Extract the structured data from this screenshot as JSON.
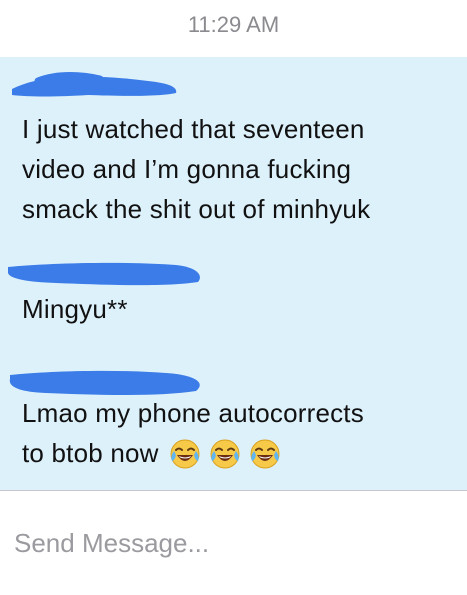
{
  "status": {
    "time": "11:29 AM"
  },
  "colors": {
    "thread_background": "#ddf1fb",
    "redaction": "#3b7ce8",
    "timestamp": "#8a8a8f",
    "placeholder": "#9a9a9f"
  },
  "messages": [
    {
      "sender": "",
      "sender_redacted": true,
      "lines": [
        "I just watched that seventeen",
        "video and I’m gonna fucking",
        "smack the shit out of minhyuk"
      ],
      "emojis": []
    },
    {
      "sender": "",
      "sender_redacted": true,
      "lines": [
        "Mingyu**"
      ],
      "emojis": []
    },
    {
      "sender": "",
      "sender_redacted": true,
      "lines": [
        "Lmao my phone autocorrects",
        "to btob now"
      ],
      "emojis": [
        "face-with-tears-of-joy-icon",
        "face-with-tears-of-joy-icon",
        "face-with-tears-of-joy-icon"
      ]
    }
  ],
  "composer": {
    "placeholder": "Send Message..."
  }
}
